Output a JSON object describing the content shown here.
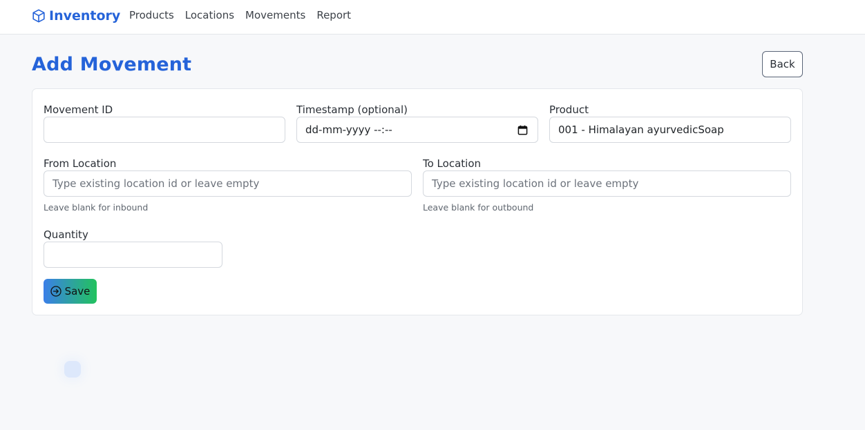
{
  "navbar": {
    "brand": "Inventory",
    "links": [
      "Products",
      "Locations",
      "Movements",
      "Report"
    ]
  },
  "page": {
    "title": "Add Movement",
    "back_label": "Back"
  },
  "form": {
    "movement_id": {
      "label": "Movement ID",
      "value": ""
    },
    "timestamp": {
      "label": "Timestamp (optional)",
      "value": "dd-mm-yyyy --:--"
    },
    "product": {
      "label": "Product",
      "value": "001 - Himalayan ayurvedicSoap"
    },
    "from_location": {
      "label": "From Location",
      "placeholder": "Type existing location id or leave empty",
      "help": "Leave blank for inbound"
    },
    "to_location": {
      "label": "To Location",
      "placeholder": "Type existing location id or leave empty",
      "help": "Leave blank for outbound"
    },
    "quantity": {
      "label": "Quantity",
      "value": ""
    },
    "save_label": "Save"
  },
  "colors": {
    "accent": "#2563d9",
    "save_gradient_start": "#3b7fe8",
    "save_gradient_end": "#22c25e"
  },
  "icons": {
    "brand": "box-icon",
    "calendar": "calendar-icon",
    "save": "arrow-circle-right-icon"
  }
}
